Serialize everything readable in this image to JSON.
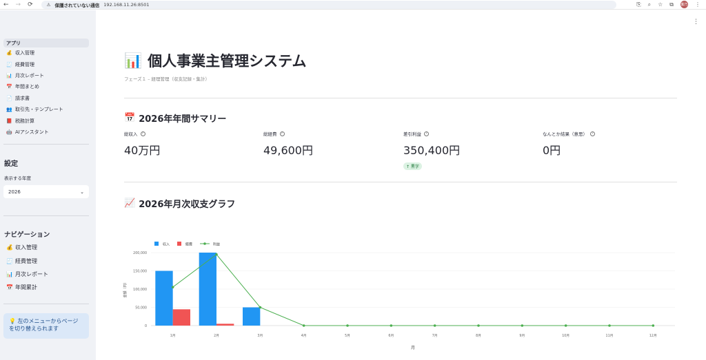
{
  "browser": {
    "security_warning": "保護されていない通信",
    "url": "192.168.11.26:8501",
    "avatar": "紫乃"
  },
  "sidebar": {
    "app_header": "アプリ",
    "pages": [
      {
        "icon": "💰",
        "label": "収入管理"
      },
      {
        "icon": "🧾",
        "label": "経費管理"
      },
      {
        "icon": "📊",
        "label": "月次レポート"
      },
      {
        "icon": "📅",
        "label": "年間まとめ"
      },
      {
        "icon": "📄",
        "label": "請求書"
      },
      {
        "icon": "👥",
        "label": "取引先・テンプレート"
      },
      {
        "icon": "📕",
        "label": "税務計算"
      },
      {
        "icon": "🤖",
        "label": "AIアシスタント"
      }
    ],
    "settings_title": "設定",
    "year_label": "表示する年度",
    "year_value": "2026",
    "nav_title": "ナビゲーション",
    "nav_items": [
      {
        "icon": "💰",
        "label": "収入管理"
      },
      {
        "icon": "🧾",
        "label": "経費管理"
      },
      {
        "icon": "📊",
        "label": "月次レポート"
      },
      {
        "icon": "📅",
        "label": "年間累計"
      }
    ],
    "info_icon": "💡",
    "info_text": "左のメニューからページを切り替えられます"
  },
  "main": {
    "title_icon": "📊",
    "title": "個人事業主管理システム",
    "subtitle": "フェーズ１ – 経理管理（収支記録・集計）",
    "summary_icon": "📅",
    "summary_title": "2026年年間サマリー",
    "metrics": [
      {
        "label": "総収入",
        "value": "40万円"
      },
      {
        "label": "総経費",
        "value": "49,600円"
      },
      {
        "label": "差引利益",
        "value": "350,400円",
        "delta": "↑ 黒字"
      },
      {
        "label": "なんとか結果（意思）",
        "value": "0円"
      }
    ],
    "chart_icon": "📈",
    "chart_title": "2026年月次収支グラフ"
  },
  "colors": {
    "income": "#2196f3",
    "expense": "#f05454",
    "profit": "#4caf50"
  },
  "chart_data": {
    "type": "bar",
    "categories": [
      "1月",
      "2月",
      "3月",
      "4月",
      "5月",
      "6月",
      "7月",
      "8月",
      "9月",
      "10月",
      "11月",
      "12月"
    ],
    "series": [
      {
        "name": "収入",
        "type": "bar",
        "values": [
          150000,
          200000,
          50000,
          0,
          0,
          0,
          0,
          0,
          0,
          0,
          0,
          0
        ]
      },
      {
        "name": "経費",
        "type": "bar",
        "values": [
          44600,
          5000,
          0,
          0,
          0,
          0,
          0,
          0,
          0,
          0,
          0,
          0
        ]
      },
      {
        "name": "利益",
        "type": "line",
        "values": [
          105400,
          195000,
          50000,
          0,
          0,
          0,
          0,
          0,
          0,
          0,
          0,
          0
        ]
      }
    ],
    "yticks": [
      "0",
      "50,000",
      "100,000",
      "150,000",
      "200,000"
    ],
    "ylim": [
      0,
      200000
    ],
    "xlabel": "月",
    "ylabel": "金額（円）",
    "legend_position": "top-left",
    "grid": true
  }
}
